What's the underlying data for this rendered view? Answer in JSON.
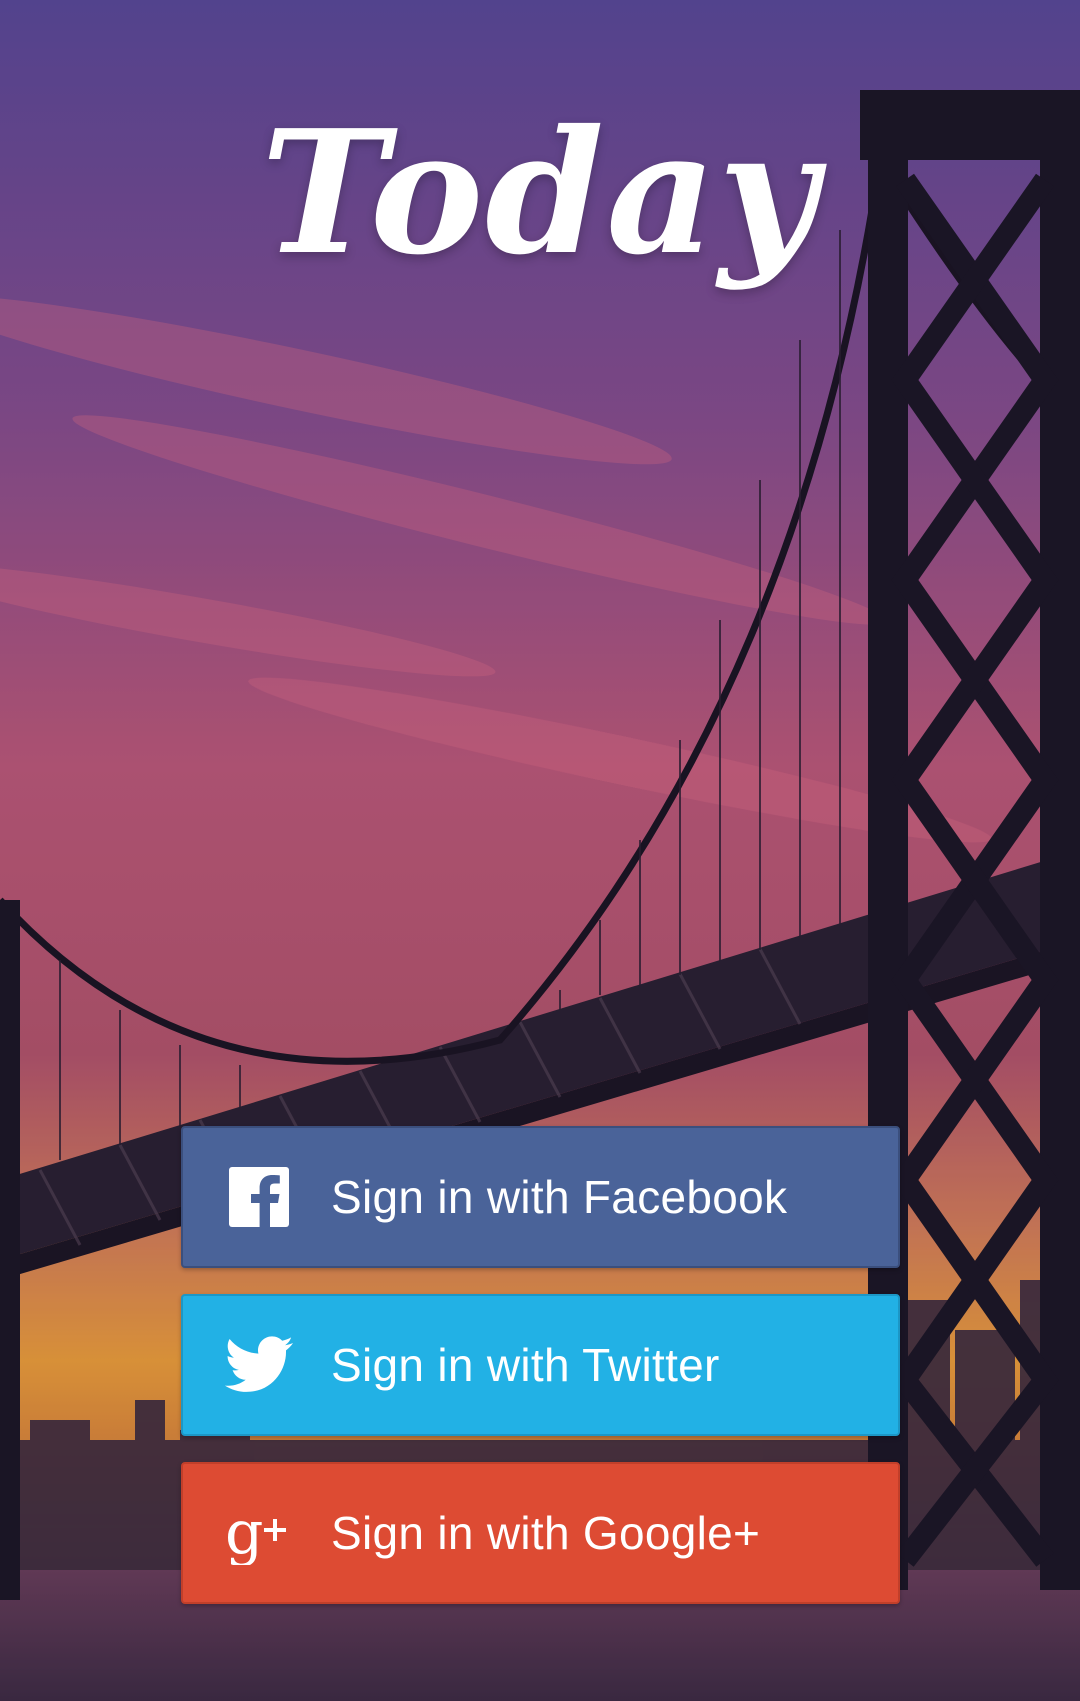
{
  "app": {
    "title": "Today"
  },
  "background": {
    "scene": "Bay Bridge at sunset",
    "sky_top": "#5b4a9a",
    "sky_mid": "#c05a7a",
    "sky_low": "#f2a23a",
    "water": "#4a2f49"
  },
  "buttons": [
    {
      "id": "facebook",
      "label": "Sign in with Facebook",
      "icon": "facebook-icon",
      "color": "#4a6399"
    },
    {
      "id": "twitter",
      "label": "Sign in with Twitter",
      "icon": "twitter-icon",
      "color": "#22b1e5"
    },
    {
      "id": "google",
      "label": "Sign in with Google+",
      "icon": "google-plus-icon",
      "color": "#dd4b33"
    }
  ]
}
